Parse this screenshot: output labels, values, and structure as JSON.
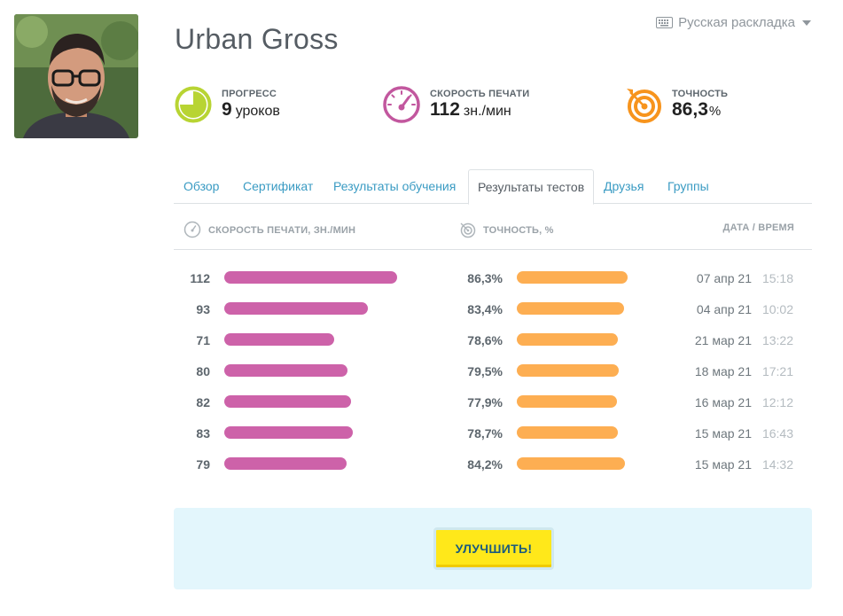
{
  "header": {
    "keyboard_layout": "Русская раскладка",
    "user_name": "Urban Gross"
  },
  "stats": {
    "progress": {
      "label": "ПРОГРЕСС",
      "value": "9",
      "unit": "уроков",
      "fill_fraction": 0.75,
      "color": "#b8d433"
    },
    "speed": {
      "label": "СКОРОСТЬ ПЕЧАТИ",
      "value": "112",
      "unit": "зн./мин",
      "color": "#c2579e"
    },
    "accuracy": {
      "label": "ТОЧНОСТЬ",
      "value": "86,3",
      "unit": "%",
      "color": "#f7941d"
    }
  },
  "tabs": [
    {
      "label": "Обзор",
      "active": false
    },
    {
      "label": "Сертификат",
      "active": false
    },
    {
      "label": "Результаты обучения",
      "active": false
    },
    {
      "label": "Результаты тестов",
      "active": true
    },
    {
      "label": "Друзья",
      "active": false
    },
    {
      "label": "Группы",
      "active": false
    }
  ],
  "table": {
    "headers": {
      "speed": "СКОРОСТЬ ПЕЧАТИ, ЗН./МИН",
      "accuracy": "ТОЧНОСТЬ, %",
      "datetime": "ДАТА / ВРЕМЯ"
    },
    "rows": [
      {
        "speed": 112,
        "accuracy": "86,3%",
        "accuracy_value": 86.3,
        "date": "07 апр 21",
        "time": "15:18"
      },
      {
        "speed": 93,
        "accuracy": "83,4%",
        "accuracy_value": 83.4,
        "date": "04 апр 21",
        "time": "10:02"
      },
      {
        "speed": 71,
        "accuracy": "78,6%",
        "accuracy_value": 78.6,
        "date": "21 мар 21",
        "time": "13:22"
      },
      {
        "speed": 80,
        "accuracy": "79,5%",
        "accuracy_value": 79.5,
        "date": "18 мар 21",
        "time": "17:21"
      },
      {
        "speed": 82,
        "accuracy": "77,9%",
        "accuracy_value": 77.9,
        "date": "16 мар 21",
        "time": "12:12"
      },
      {
        "speed": 83,
        "accuracy": "78,7%",
        "accuracy_value": 78.7,
        "date": "15 мар 21",
        "time": "16:43"
      },
      {
        "speed": 79,
        "accuracy": "84,2%",
        "accuracy_value": 84.2,
        "date": "15 мар 21",
        "time": "14:32"
      }
    ]
  },
  "upgrade": {
    "button_label": "УЛУЧШИТЬ!"
  },
  "colors": {
    "speed_bar": "#cd62a9",
    "accuracy_bar": "#fdae52",
    "link": "#3a9bc3",
    "button": "#ffe81a"
  }
}
